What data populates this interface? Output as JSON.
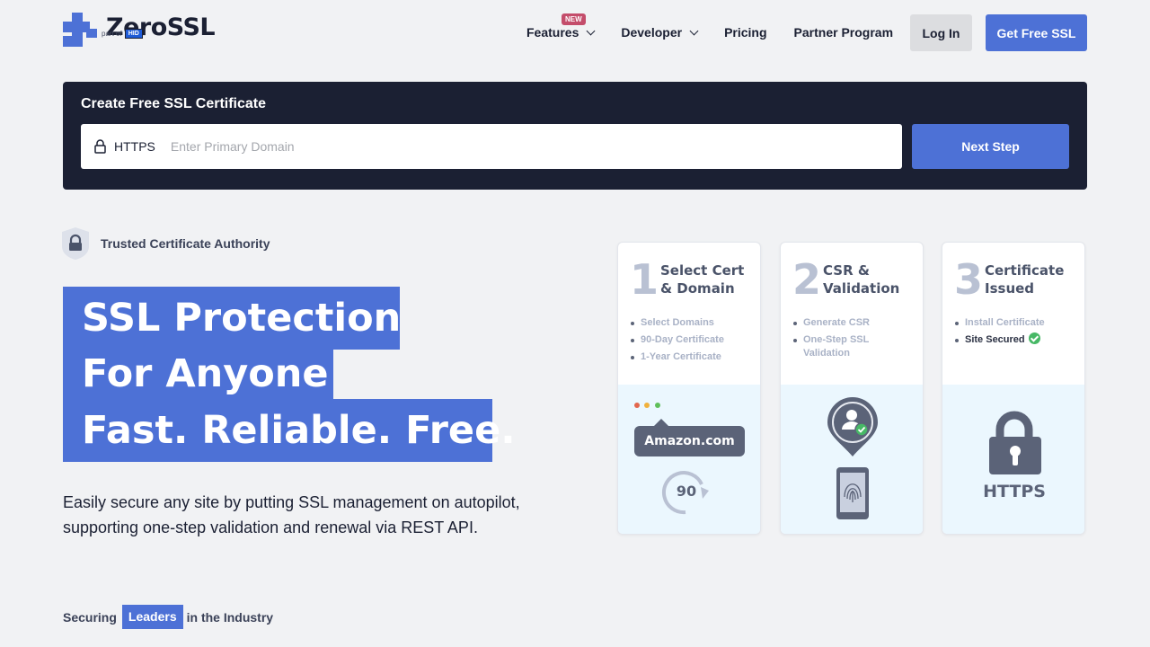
{
  "header": {
    "logo_text": "ZeroSSL",
    "logo_sub": "part of",
    "logo_sub_brand": "HID",
    "nav": [
      {
        "label": "Features",
        "badge": "NEW",
        "has_dropdown": true
      },
      {
        "label": "Developer",
        "has_dropdown": true
      },
      {
        "label": "Pricing",
        "has_dropdown": false
      },
      {
        "label": "Partner Program",
        "has_dropdown": false
      }
    ],
    "login_label": "Log In",
    "cta_label": "Get Free SSL"
  },
  "create": {
    "title": "Create Free SSL Certificate",
    "protocol": "HTTPS",
    "placeholder": "Enter Primary Domain",
    "value": "",
    "button_label": "Next Step"
  },
  "hero": {
    "trusted_label": "Trusted Certificate Authority",
    "headline": [
      "SSL Protection",
      "For Anyone",
      "Fast. Reliable. Free."
    ],
    "description": "Easily secure any site by putting SSL management on autopilot, supporting one-step validation and renewal via REST API.",
    "securing_prefix": "Securing",
    "securing_highlight": "Leaders",
    "securing_suffix": "in the Industry"
  },
  "steps": [
    {
      "number": "1",
      "title_line1": "Select Cert",
      "title_line2": "& Domain",
      "items": [
        "Select Domains",
        "90-Day Certificate",
        "1-Year Certificate"
      ],
      "illustration": {
        "domain_label": "Amazon.com",
        "days": "90",
        "icon": "renew-icon"
      }
    },
    {
      "number": "2",
      "title_line1": "CSR &",
      "title_line2": "Validation",
      "items": [
        "Generate CSR",
        "One-Step SSL Validation"
      ],
      "illustration": {
        "icon": "fingerprint-phone-icon"
      }
    },
    {
      "number": "3",
      "title_line1": "Certificate",
      "title_line2": "Issued",
      "items": [
        "Install Certificate",
        "Site Secured"
      ],
      "illustration": {
        "label": "HTTPS",
        "icon": "padlock-icon"
      }
    }
  ],
  "colors": {
    "accent": "#4d71d6",
    "dark": "#1b2033",
    "background": "#f1f2f4",
    "new_badge": "#c44d6b",
    "success": "#47b866"
  }
}
